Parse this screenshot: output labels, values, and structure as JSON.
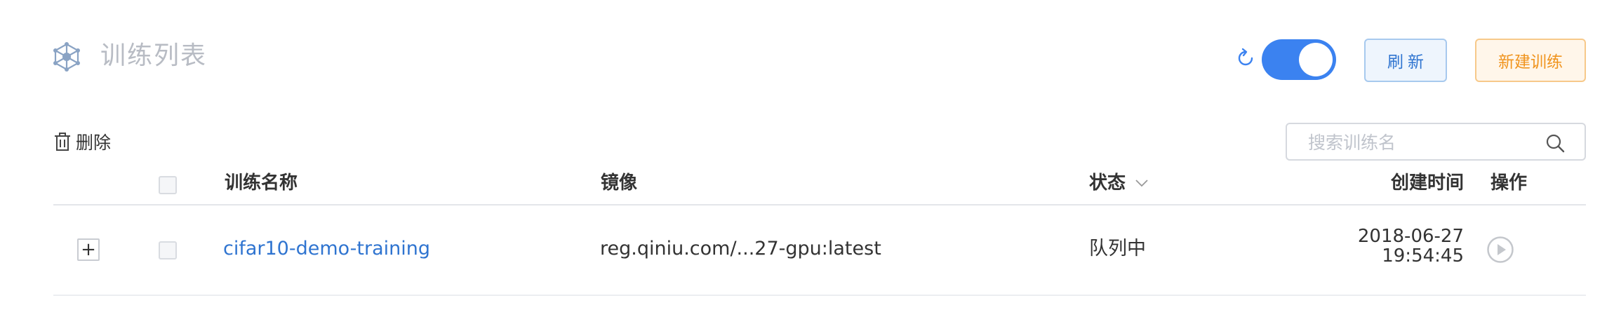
{
  "header": {
    "title": "训练列表",
    "title_icon": "network-icon",
    "auto_refresh_enabled": true,
    "refresh_button_label": "刷新",
    "new_button_label": "新建训练"
  },
  "toolbar": {
    "delete_label": "删除",
    "search_placeholder": "搜索训练名",
    "search_value": ""
  },
  "table": {
    "columns": {
      "name": "训练名称",
      "image": "镜像",
      "status": "状态",
      "created": "创建时间",
      "actions": "操作"
    },
    "rows": [
      {
        "name": "cifar10-demo-training",
        "image": "reg.qiniu.com/...27-gpu:latest",
        "status": "队列中",
        "created_date": "2018-06-27",
        "created_time": "19:54:45",
        "expand": "+"
      }
    ]
  },
  "colors": {
    "accent_blue": "#3b82f0",
    "link_blue": "#2f74d0",
    "orange": "#f0941e",
    "title_gray": "#b8bcc4"
  }
}
